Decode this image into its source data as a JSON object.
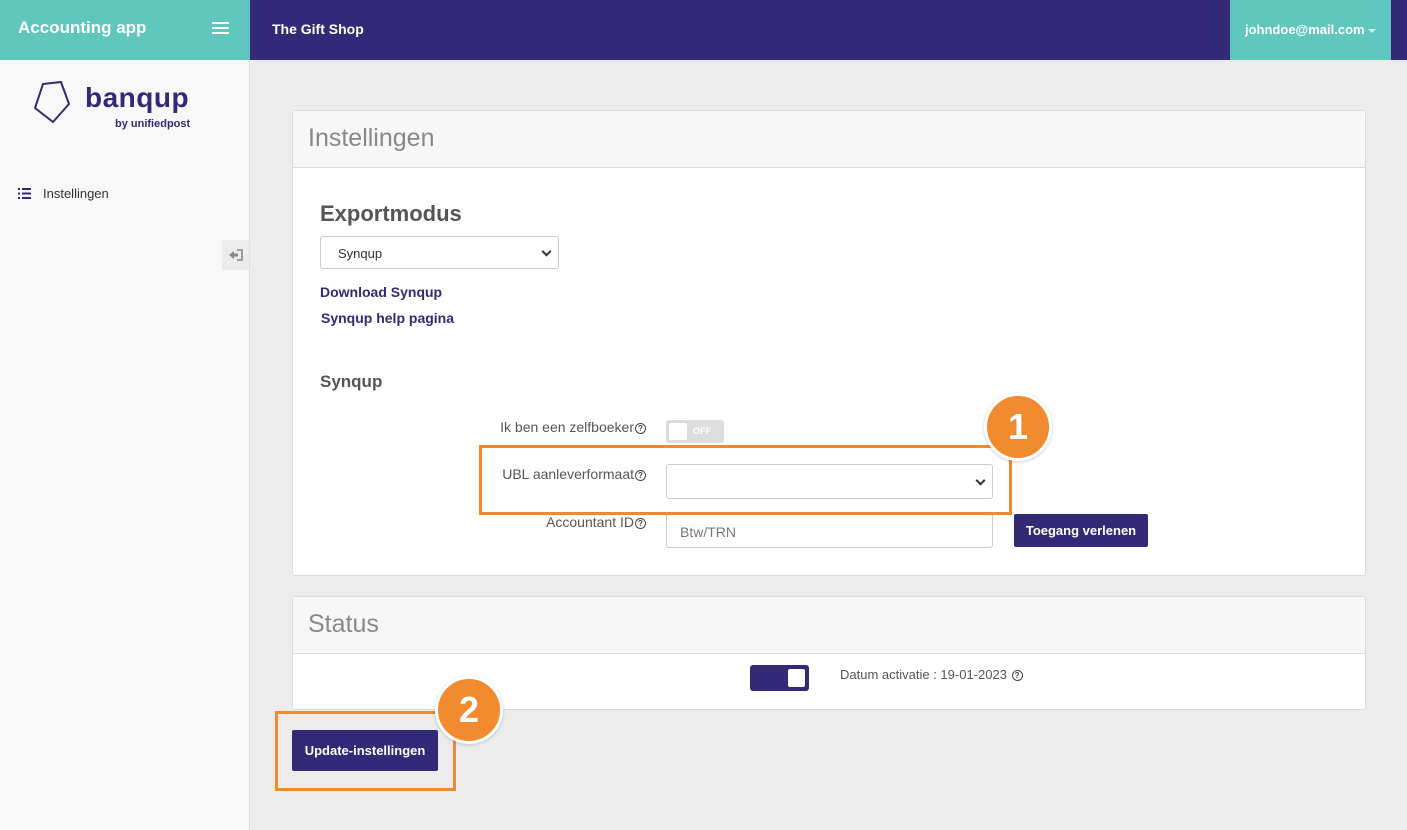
{
  "app": {
    "title": "Accounting app",
    "shop_name": "The Gift Shop",
    "user_email": "johndoe@mail.com"
  },
  "logo": {
    "word": "banqup",
    "sub": "by unifiedpost"
  },
  "sidebar": {
    "items": [
      {
        "label": "Instellingen",
        "icon": "list-icon"
      }
    ]
  },
  "settings_panel": {
    "title": "Instellingen",
    "export_heading": "Exportmodus",
    "export_select_value": "Synqup",
    "links": [
      "Download Synqup",
      "Synqup help pagina"
    ],
    "synqup_heading": "Synqup",
    "self_booker_label": "Ik ben een zelfboeker",
    "self_booker_toggle": "OFF",
    "ubl_label": "UBL aanleverformaat",
    "ubl_value": "",
    "accountant_label": "Accountant ID",
    "accountant_placeholder": "Btw/TRN",
    "grant_access_label": "Toegang verlenen"
  },
  "status_panel": {
    "title": "Status",
    "activation_text": "Datum activatie : 19-01-2023",
    "toggle_on": true
  },
  "update_button_label": "Update-instellingen",
  "annotations": {
    "badge1": "1",
    "badge2": "2",
    "color": "#f28a30"
  },
  "colors": {
    "primary": "#322a77",
    "teal": "#5fc7bd",
    "orange": "#f08a2c"
  }
}
